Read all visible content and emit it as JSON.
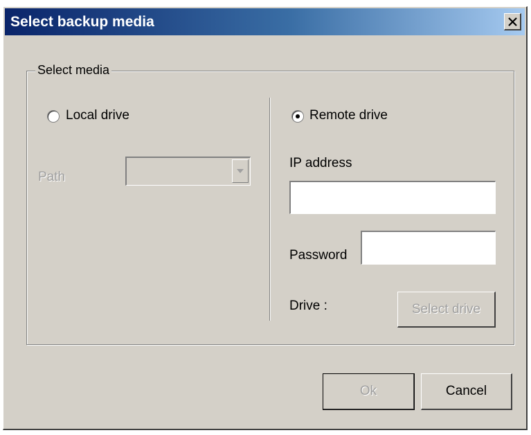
{
  "window": {
    "title": "Select backup media",
    "close_glyph": "✕"
  },
  "group": {
    "legend": "Select media"
  },
  "local": {
    "radio_label": "Local drive",
    "selected": false,
    "path_label": "Path",
    "path_value": ""
  },
  "remote": {
    "radio_label": "Remote drive",
    "selected": true,
    "ip_label": "IP address",
    "ip_value": "",
    "password_label": "Password",
    "password_value": "",
    "drive_label": "Drive :",
    "select_drive_button": "Select drive"
  },
  "buttons": {
    "ok_label": "Ok",
    "cancel_label": "Cancel"
  }
}
